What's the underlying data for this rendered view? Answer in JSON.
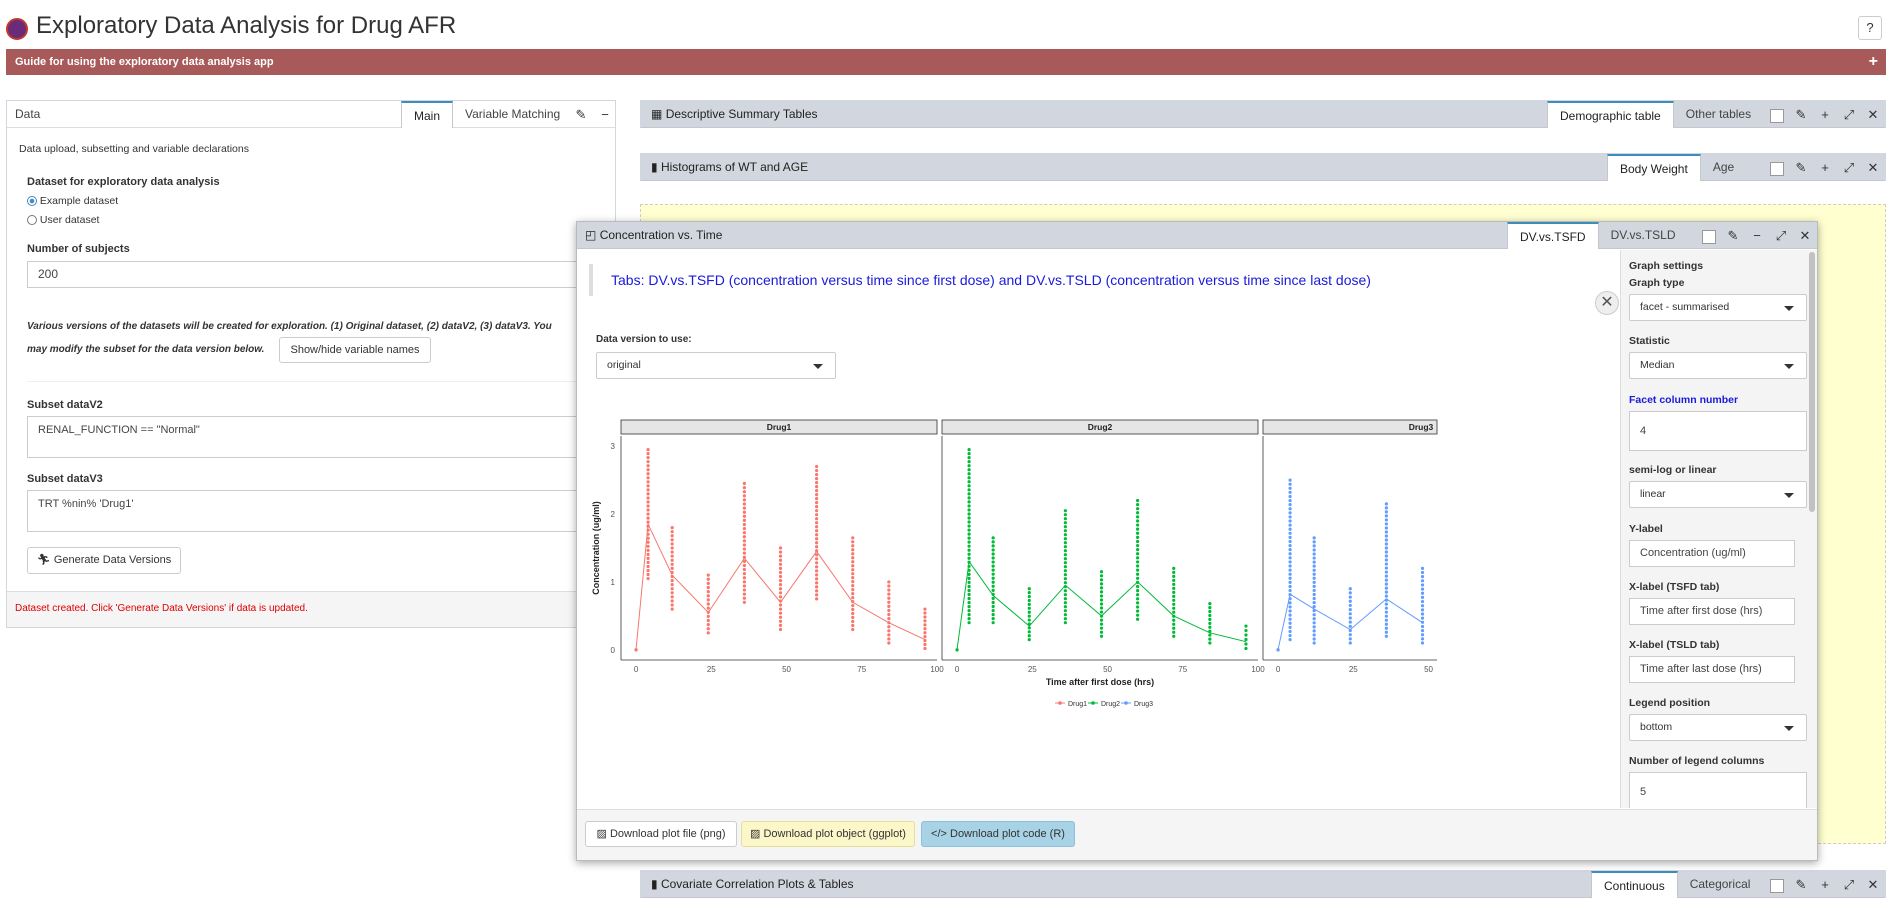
{
  "app": {
    "title": "Exploratory Data Analysis for Drug AFR",
    "help": "?"
  },
  "guide": {
    "label": "Guide for using the exploratory data analysis app",
    "toggle": "+"
  },
  "data_panel": {
    "title": "Data",
    "tabs": [
      "Main",
      "Variable Matching"
    ],
    "intro": "Data upload, subsetting and variable declarations",
    "dataset_label": "Dataset for exploratory data analysis",
    "radio_options": [
      "Example dataset",
      "User dataset"
    ],
    "radio_selected": 0,
    "subjects_label": "Number of subjects",
    "subjects_value": "200",
    "versions_note_1": "Various versions of the datasets will be created for exploration. (1) Original dataset, (2) dataV2, (3) dataV3. You",
    "versions_note_2": "may modify the subset for the data version below.",
    "show_hide_btn": "Show/hide variable names",
    "subset_v2_label": "Subset dataV2",
    "subset_v2_value": "RENAL_FUNCTION == \"Normal\"",
    "subset_v3_label": "Subset dataV3",
    "subset_v3_value": "TRT %nin% 'Drug1'",
    "generate_btn": "Generate Data Versions",
    "status": "Dataset created. Click 'Generate Data Versions' if data is updated.",
    "status_color": "#e00000"
  },
  "desc_panel": {
    "title": "Descriptive Summary Tables",
    "tabs": [
      "Demographic table",
      "Other tables"
    ]
  },
  "hist_panel": {
    "title": "Histograms of WT and AGE",
    "tabs": [
      "Body Weight",
      "Age"
    ]
  },
  "cov_panel": {
    "title": "Covariate Correlation Plots & Tables",
    "tabs": [
      "Continuous",
      "Categorical"
    ]
  },
  "conc_panel": {
    "title": "Concentration vs. Time",
    "tabs": [
      "DV.vs.TSFD",
      "DV.vs.TSLD"
    ],
    "info": "Tabs: DV.vs.TSFD (concentration versus time since first dose) and DV.vs.TSLD (concentration versus time since last dose)",
    "version_label": "Data version to use:",
    "version_value": "original",
    "downloads": [
      "Download plot file (png)",
      "Download plot object (ggplot)",
      "Download plot code (R)"
    ]
  },
  "graph_settings": {
    "title": "Graph settings",
    "graph_type_label": "Graph type",
    "graph_type_value": "facet - summarised",
    "statistic_label": "Statistic",
    "statistic_value": "Median",
    "facet_label": "Facet column number",
    "facet_value": "4",
    "scale_label": "semi-log or linear",
    "scale_value": "linear",
    "ylabel_label": "Y-label",
    "ylabel_value": "Concentration (ug/ml)",
    "xlabel_tsfd_label": "X-label (TSFD tab)",
    "xlabel_tsfd_value": "Time after first dose (hrs)",
    "xlabel_tsld_label": "X-label (TSLD tab)",
    "xlabel_tsld_value": "Time after last dose (hrs)",
    "legend_pos_label": "Legend position",
    "legend_pos_value": "bottom",
    "legend_cols_label": "Number of legend columns",
    "legend_cols_value": "5"
  },
  "colors": {
    "drug1": "#f8766d",
    "drug2": "#00ba38",
    "drug3": "#619cff",
    "guide_bar": "#a85a5a",
    "accent": "#3c8dbc"
  },
  "chart_data": {
    "type": "scatter",
    "facets": [
      "Drug1",
      "Drug2",
      "Drug3"
    ],
    "ylabel": "Concentration (ug/ml)",
    "xlabel": "Time after first dose (hrs)",
    "xticks": [
      "0",
      "25",
      "50",
      "75",
      "100"
    ],
    "yticks": [
      "0",
      "1",
      "2",
      "3"
    ],
    "xlim": [
      -5,
      100
    ],
    "ylim": [
      -0.15,
      3.15
    ],
    "x": [
      0,
      4,
      12,
      24,
      36,
      48,
      60,
      72,
      84,
      96
    ],
    "series": [
      {
        "name": "Drug1",
        "median": [
          0,
          1.85,
          1.1,
          0.55,
          1.35,
          0.7,
          1.45,
          0.7,
          0.4,
          0.15
        ],
        "max": [
          0,
          2.95,
          1.8,
          1.1,
          2.45,
          1.5,
          2.7,
          1.65,
          1.0,
          0.6
        ],
        "min": [
          0,
          1.05,
          0.6,
          0.25,
          0.7,
          0.3,
          0.75,
          0.3,
          0.1,
          0.02
        ]
      },
      {
        "name": "Drug2",
        "median": [
          0,
          1.3,
          0.8,
          0.35,
          0.95,
          0.5,
          1.0,
          0.5,
          0.25,
          0.12
        ],
        "max": [
          0,
          2.95,
          1.65,
          0.9,
          2.05,
          1.15,
          2.2,
          1.2,
          0.68,
          0.35
        ],
        "min": [
          0,
          0.4,
          0.4,
          0.15,
          0.4,
          0.2,
          0.45,
          0.2,
          0.1,
          0.02
        ]
      },
      {
        "name": "Drug3",
        "median": [
          0,
          0.82,
          0.6,
          0.3,
          0.75,
          0.4
        ],
        "max": [
          0,
          2.5,
          1.65,
          0.9,
          2.15,
          1.2
        ],
        "min": [
          0,
          0.15,
          0.1,
          0.1,
          0.2,
          0.1
        ]
      }
    ],
    "legend": [
      "Drug1",
      "Drug2",
      "Drug3"
    ],
    "legend_position": "bottom",
    "grid": false
  }
}
